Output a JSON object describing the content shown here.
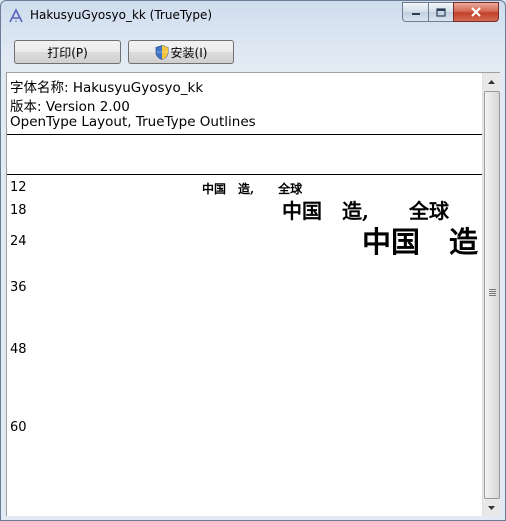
{
  "window": {
    "title": "HakusyuGyosyo_kk (TrueType)",
    "icon": "font-file-icon",
    "caption_buttons": [
      "minimize-icon",
      "maximize-icon",
      "close-icon"
    ]
  },
  "toolbar": {
    "print_label": "打印(P)",
    "install_label": "安装(I)",
    "install_icon": "uac-shield-icon"
  },
  "font_info": {
    "name_line": "字体名称: HakusyuGyosyo_kk",
    "version_line": "版本: Version 2.00",
    "type_line": "OpenType Layout, TrueType Outlines"
  },
  "samples": [
    {
      "size": "12",
      "text": "中国　造,　　全球"
    },
    {
      "size": "18",
      "text": "中国　造,　　全球"
    },
    {
      "size": "24",
      "text": "中国　造"
    },
    {
      "size": "36",
      "text": ""
    },
    {
      "size": "48",
      "text": ""
    },
    {
      "size": "60",
      "text": ""
    }
  ],
  "colors": {
    "frame": "#6b7d96",
    "close_button": "#c2402b",
    "content_bg": "#ffffff"
  }
}
